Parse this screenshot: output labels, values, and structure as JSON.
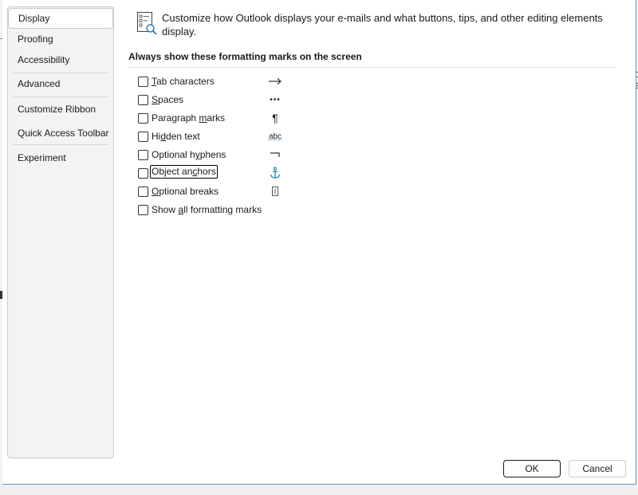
{
  "sidebar": {
    "items": [
      {
        "label": "Display"
      },
      {
        "label": "Proofing"
      },
      {
        "label": "Accessibility"
      },
      {
        "label": "Advanced"
      },
      {
        "label": "Customize Ribbon"
      },
      {
        "label": "Quick Access Toolbar"
      },
      {
        "label": "Experiment"
      }
    ],
    "active": "Display"
  },
  "header": {
    "line1": "Customize how Outlook displays your e-mails and what buttons, tips, and other editing elements",
    "line2": "display."
  },
  "section": {
    "title": "Always show these formatting marks on the screen"
  },
  "options": [
    {
      "pre": "",
      "ul": "T",
      "post": "ab characters",
      "checked": false,
      "mark": "arrow-right-icon"
    },
    {
      "pre": "",
      "ul": "S",
      "post": "paces",
      "checked": false,
      "mark": "dots-icon"
    },
    {
      "pre": "Paragraph ",
      "ul": "m",
      "post": "arks",
      "checked": false,
      "mark": "pilcrow-icon"
    },
    {
      "pre": "Hi",
      "ul": "d",
      "post": "den text",
      "checked": false,
      "mark": "hidden-text-icon"
    },
    {
      "pre": "Optional h",
      "ul": "y",
      "post": "phens",
      "checked": false,
      "mark": "optional-hyphen-icon"
    },
    {
      "pre": "Object an",
      "ul": "c",
      "post": "hors",
      "checked": false,
      "mark": "anchor-icon"
    },
    {
      "pre": "",
      "ul": "O",
      "post": "ptional breaks",
      "checked": false,
      "mark": "optional-break-icon"
    },
    {
      "pre": "Show ",
      "ul": "a",
      "post": "ll formatting marks",
      "checked": false,
      "mark": ""
    }
  ],
  "marks": {
    "pilcrow": "¶",
    "hidden": "abc",
    "dots": "•••"
  },
  "buttons": {
    "ok": "OK",
    "cancel": "Cancel"
  },
  "background": {
    "right_text": [
      "C",
      "S"
    ]
  },
  "colors": {
    "accent": "#1e7fc0",
    "dialog_border": "#6f8fb8"
  }
}
